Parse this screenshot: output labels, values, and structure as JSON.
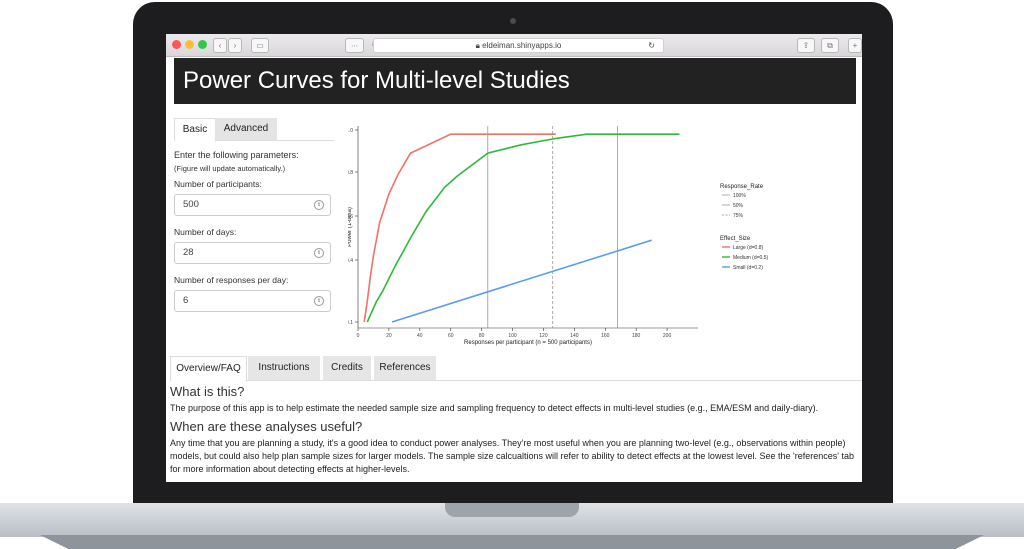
{
  "browser": {
    "url": "eldeiman.shinyapps.io"
  },
  "app": {
    "title": "Power Curves for Multi-level Studies"
  },
  "side_tabs": [
    {
      "label": "Basic"
    },
    {
      "label": "Advanced"
    }
  ],
  "form": {
    "intro": "Enter the following parameters:",
    "note": "(Figure will update automatically.)",
    "participants_label": "Number of participants:",
    "participants_value": "500",
    "days_label": "Number of days:",
    "days_value": "28",
    "responses_label": "Number of responses per day:",
    "responses_value": "6"
  },
  "chart_data": {
    "type": "line",
    "xlabel": "Responses per participant (n = 500 participants)",
    "ylabel": "Power (1-beta)",
    "xlim": [
      0,
      220
    ],
    "ylim": [
      0.1,
      1.0
    ],
    "xticks": [
      "0",
      "20",
      "40",
      "60",
      "80",
      "100",
      "120",
      "140",
      "160",
      "180",
      "200"
    ],
    "yticks": [
      "0.1",
      "0.4",
      "0.6",
      "0.8",
      "1.0"
    ],
    "series": [
      {
        "name": "Large (d=0.8)",
        "color": "#f07167",
        "x": [
          4,
          6,
          8,
          10,
          14,
          20,
          26,
          34,
          60,
          128
        ],
        "y": [
          0.1,
          0.2,
          0.32,
          0.42,
          0.57,
          0.7,
          0.79,
          0.89,
          0.98,
          0.98
        ]
      },
      {
        "name": "Medium (d=0.5)",
        "color": "#2cba38",
        "x": [
          6,
          12,
          16,
          24,
          34,
          44,
          56,
          64,
          84,
          106,
          128,
          148,
          208
        ],
        "y": [
          0.1,
          0.2,
          0.25,
          0.37,
          0.5,
          0.62,
          0.73,
          0.78,
          0.89,
          0.93,
          0.96,
          0.98,
          0.98
        ]
      },
      {
        "name": "Small (d=0.2)",
        "color": "#5b9cf2",
        "x": [
          22,
          190
        ],
        "y": [
          0.1,
          0.49
        ]
      }
    ],
    "vlines": [
      {
        "name": "100%",
        "x": 84,
        "style": "solid"
      },
      {
        "name": "50%",
        "x": 168,
        "style": "solid"
      },
      {
        "name": "75%",
        "x": 126,
        "style": "dashed"
      }
    ],
    "legend": {
      "response_title": "Response_Rate",
      "response_items": [
        "100%",
        "50%",
        "75%"
      ],
      "effect_title": "Effect_Size",
      "effect_items": [
        "Large (d=0.8)",
        "Medium (d=0.5)",
        "Small (d=0.2)"
      ]
    }
  },
  "bottom_tabs": [
    {
      "label": "Overview/FAQ"
    },
    {
      "label": "Instructions"
    },
    {
      "label": "Credits"
    },
    {
      "label": "References"
    }
  ],
  "overview": {
    "h1": "What is this?",
    "p1": "The purpose of this app is to help estimate the needed sample size and sampling frequency to detect effects in multi-level studies (e.g., EMA/ESM and daily-diary).",
    "h2": "When are these analyses useful?",
    "p2": "Any time that you are planning a study, it's a good idea to conduct power analyses. They're most useful when you are planning two-level (e.g., observations within people) models, but could also help plan sample sizes for larger models. The sample size calcualtions will refer to ability to detect effects at the lowest level. See the 'references' tab for more information about detecting effects at higher-levels."
  }
}
